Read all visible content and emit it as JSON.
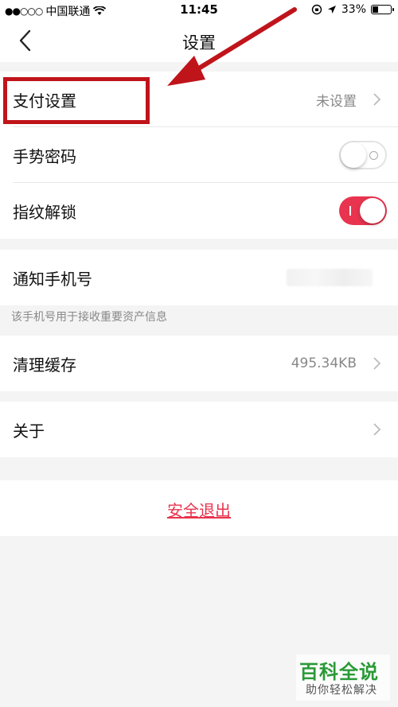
{
  "status_bar": {
    "signal": "●●○○○",
    "carrier": "中国联通",
    "time": "11:45",
    "battery_percent": "33%",
    "battery_level": 0.33
  },
  "nav": {
    "title": "设置"
  },
  "settings": {
    "payment": {
      "label": "支付设置",
      "value": "未设置"
    },
    "gesture": {
      "label": "手势密码",
      "enabled": false
    },
    "fingerprint": {
      "label": "指纹解锁",
      "enabled": true
    },
    "phone": {
      "label": "通知手机号",
      "hint": "该手机号用于接收重要资产信息"
    },
    "cache": {
      "label": "清理缓存",
      "value": "495.34KB"
    },
    "about": {
      "label": "关于"
    }
  },
  "logout_label": "安全退出",
  "watermark": {
    "title": "百科全说",
    "subtitle": "助你轻松解决"
  },
  "colors": {
    "accent": "#e8344e",
    "annotation": "#c0141b",
    "watermark_green": "#2a9a37"
  }
}
